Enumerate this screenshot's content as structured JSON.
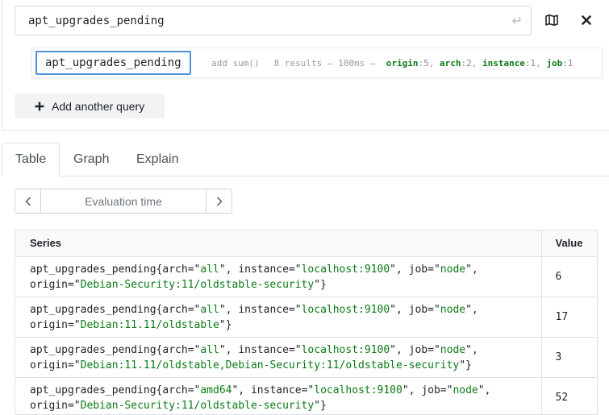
{
  "query": {
    "expression": "apt_upgrades_pending",
    "enter_icon": "↵"
  },
  "tree": {
    "node_label": "apt_upgrades_pending",
    "add_sum": "add sum()",
    "stats": "8 results – 100ms –",
    "labels": [
      {
        "name": "origin",
        "count": ":5"
      },
      {
        "name": "arch",
        "count": ":2"
      },
      {
        "name": "instance",
        "count": ":1"
      },
      {
        "name": "job",
        "count": ":1"
      }
    ]
  },
  "add_query_label": "Add another query",
  "tabs": [
    {
      "label": "Table",
      "active": true
    },
    {
      "label": "Graph",
      "active": false
    },
    {
      "label": "Explain",
      "active": false
    }
  ],
  "eval_time_placeholder": "Evaluation time",
  "table": {
    "headers": {
      "series": "Series",
      "value": "Value"
    },
    "rows": [
      {
        "metric": "apt_upgrades_pending",
        "arch": "all",
        "instance": "localhost:9100",
        "job": "node",
        "origin": "Debian-Security:11/oldstable-security",
        "value": "6"
      },
      {
        "metric": "apt_upgrades_pending",
        "arch": "all",
        "instance": "localhost:9100",
        "job": "node",
        "origin": "Debian:11.11/oldstable",
        "value": "17"
      },
      {
        "metric": "apt_upgrades_pending",
        "arch": "all",
        "instance": "localhost:9100",
        "job": "node",
        "origin": "Debian:11.11/oldstable,Debian-Security:11/oldstable-security",
        "value": "3"
      },
      {
        "metric": "apt_upgrades_pending",
        "arch": "amd64",
        "instance": "localhost:9100",
        "job": "node",
        "origin": "Debian-Security:11/oldstable-security",
        "value": "52"
      }
    ]
  },
  "icons": {
    "enter": "enter-icon",
    "metrics_explorer": "map-icon",
    "remove": "close-icon",
    "add": "plus-icon",
    "prev": "chevron-left-icon",
    "next": "chevron-right-icon"
  }
}
